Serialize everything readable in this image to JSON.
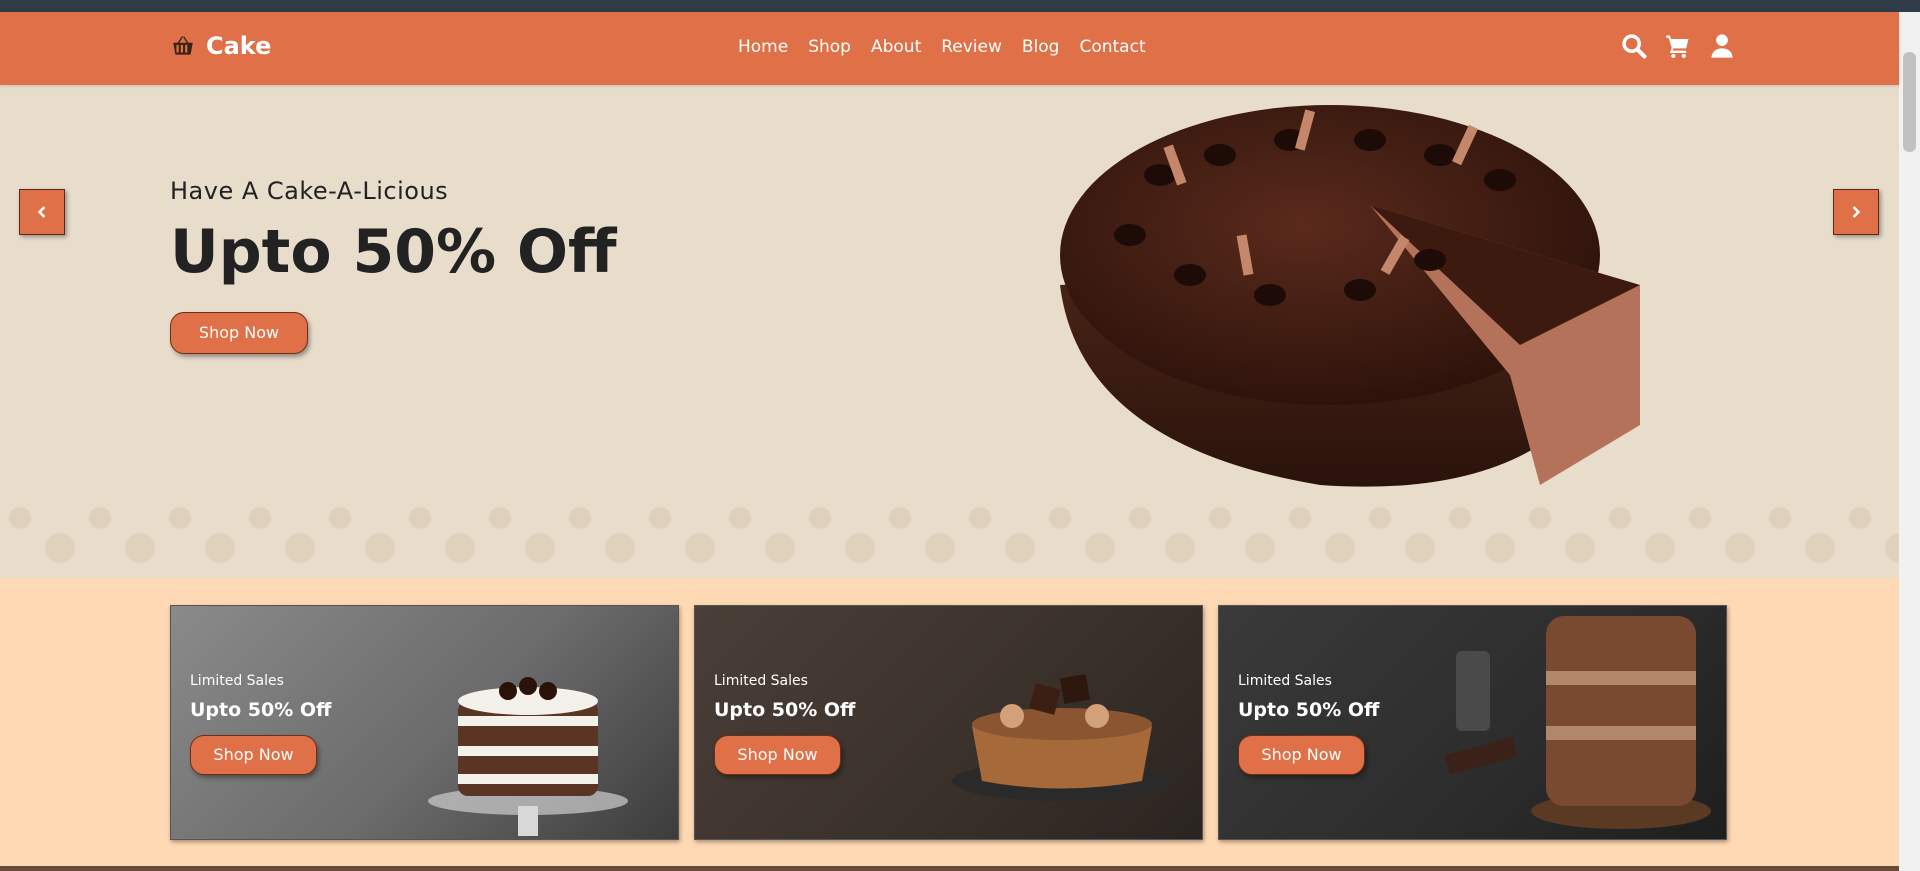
{
  "header": {
    "logo_text": "Cake",
    "logo_icon": "basket-icon",
    "nav": [
      "Home",
      "Shop",
      "About",
      "Review",
      "Blog",
      "Contact"
    ],
    "icons": [
      "search-icon",
      "cart-icon",
      "user-icon"
    ]
  },
  "hero": {
    "subtitle": "Have A Cake-A-Licious",
    "title": "Upto 50% Off",
    "button": "Shop Now",
    "prev_icon": "chevron-left-icon",
    "next_icon": "chevron-right-icon"
  },
  "cards": [
    {
      "label": "Limited Sales",
      "title": "Upto 50% Off",
      "button": "Shop Now"
    },
    {
      "label": "Limited Sales",
      "title": "Upto 50% Off",
      "button": "Shop Now"
    },
    {
      "label": "Limited Sales",
      "title": "Upto 50% Off",
      "button": "Shop Now"
    }
  ],
  "colors": {
    "accent": "#e07047",
    "hero_bg": "#e8dccb",
    "section_bg": "#ffd8b4",
    "top_strip": "#2f3b47"
  }
}
